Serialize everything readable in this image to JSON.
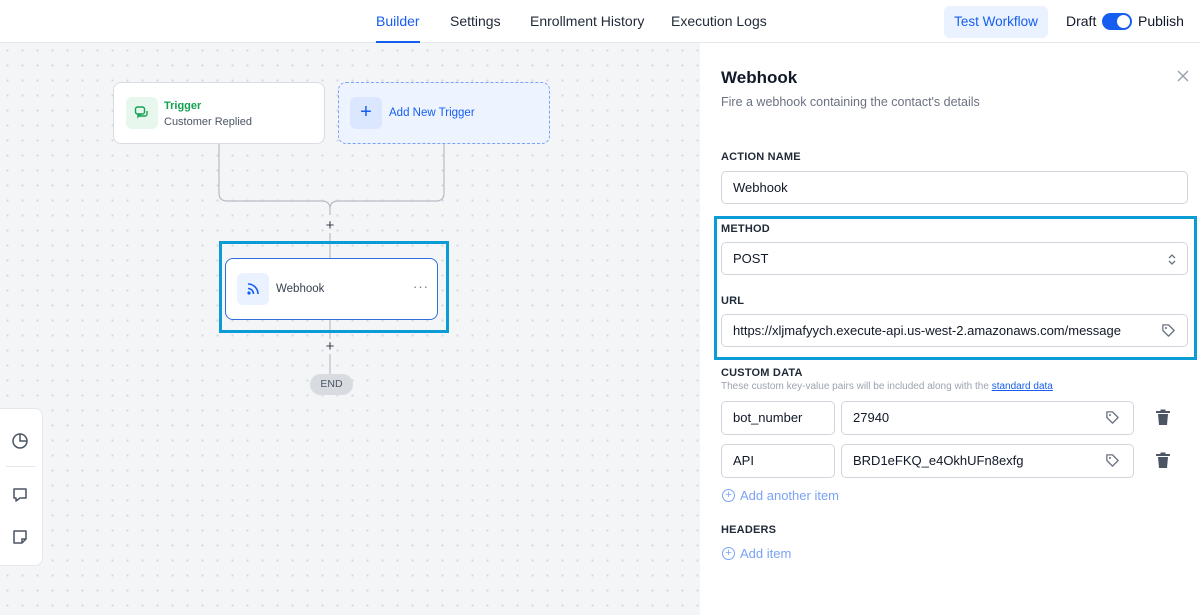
{
  "topbar": {
    "tabs": [
      {
        "label": "Builder",
        "active": true
      },
      {
        "label": "Settings",
        "active": false
      },
      {
        "label": "Enrollment History",
        "active": false
      },
      {
        "label": "Execution Logs",
        "active": false
      }
    ],
    "test_workflow": "Test Workflow",
    "draft_label": "Draft",
    "publish_label": "Publish",
    "publish_toggle_on": true
  },
  "canvas": {
    "trigger": {
      "title": "Trigger",
      "subtitle": "Customer Replied"
    },
    "add_trigger": "Add New Trigger",
    "webhook_node": {
      "label": "Webhook",
      "menu": "···"
    },
    "end": "END",
    "plus": "+"
  },
  "panel": {
    "title": "Webhook",
    "subtitle": "Fire a webhook containing the contact's details",
    "action_name_label": "ACTION NAME",
    "action_name_value": "Webhook",
    "method_label": "METHOD",
    "method_value": "POST",
    "url_label": "URL",
    "url_value": "https://xljmafyych.execute-api.us-west-2.amazonaws.com/message",
    "custom_data_label": "CUSTOM DATA",
    "custom_data_desc": "These custom key-value pairs will be included along with the",
    "custom_data_link": "standard data",
    "custom_data": [
      {
        "key": "bot_number",
        "value": "27940"
      },
      {
        "key": "API",
        "value": "BRD1eFKQ_e4OkhUFn8exfg"
      }
    ],
    "add_another_item": "Add another item",
    "headers_label": "HEADERS",
    "add_item": "Add item"
  },
  "colors": {
    "accent": "#155eef",
    "highlight": "#0b9bd5",
    "trigger_green": "#12a150"
  }
}
